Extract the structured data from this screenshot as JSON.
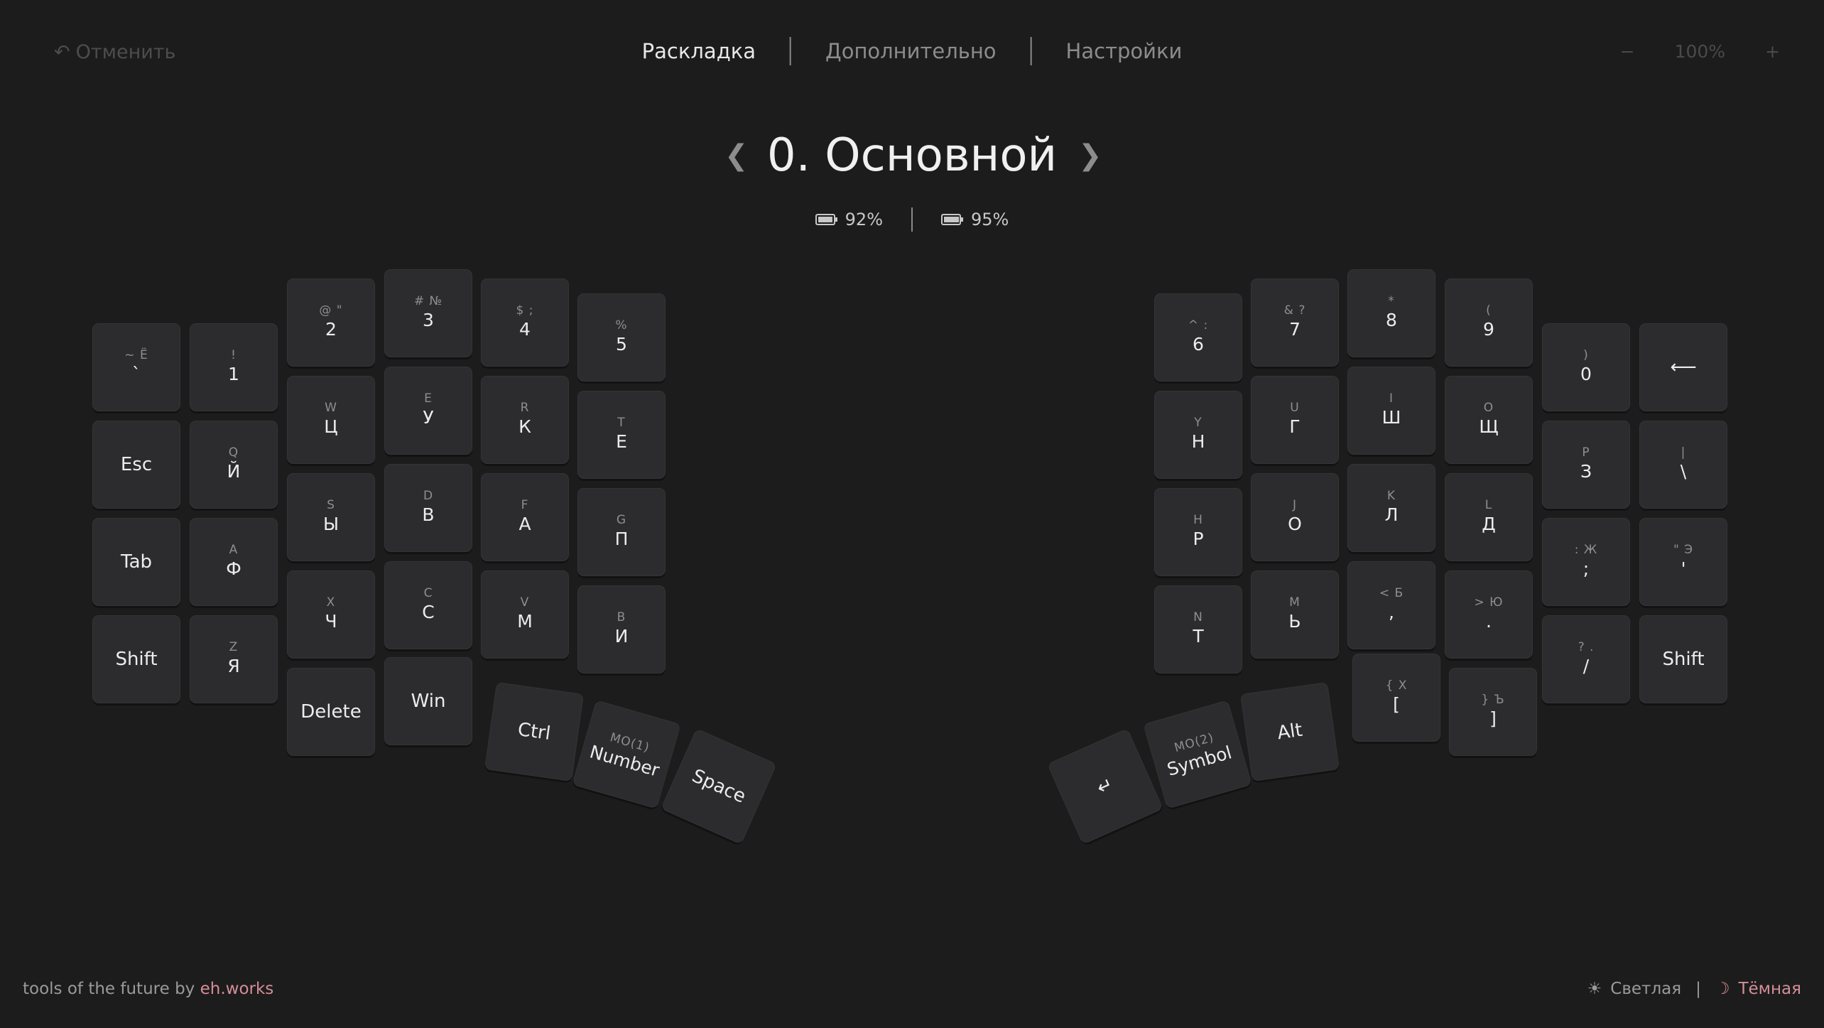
{
  "header": {
    "undo_label": "Отменить",
    "tabs": [
      {
        "label": "Раскладка",
        "active": true
      },
      {
        "label": "Дополнительно",
        "active": false
      },
      {
        "label": "Настройки",
        "active": false
      }
    ],
    "zoom_minus": "−",
    "zoom_value": "100%",
    "zoom_plus": "+"
  },
  "layer": {
    "title": "0. Основной",
    "prev": "❮",
    "next": "❯"
  },
  "battery": {
    "left": "92%",
    "right": "95%"
  },
  "left_keys": [
    {
      "id": "lk-grave",
      "top": "~ Ё",
      "main": "`"
    },
    {
      "id": "lk-1",
      "top": "!",
      "main": "1"
    },
    {
      "id": "lk-2",
      "top": "@ \"",
      "main": "2"
    },
    {
      "id": "lk-3",
      "top": "# №",
      "main": "3"
    },
    {
      "id": "lk-4",
      "top": "$ ;",
      "main": "4"
    },
    {
      "id": "lk-5",
      "top": "%",
      "main": "5"
    },
    {
      "id": "lk-esc",
      "top": "",
      "main": "Esc"
    },
    {
      "id": "lk-q",
      "top": "Q",
      "main": "Й"
    },
    {
      "id": "lk-w",
      "top": "W",
      "main": "Ц"
    },
    {
      "id": "lk-e",
      "top": "E",
      "main": "У"
    },
    {
      "id": "lk-r",
      "top": "R",
      "main": "К"
    },
    {
      "id": "lk-t",
      "top": "T",
      "main": "Е"
    },
    {
      "id": "lk-tab",
      "top": "",
      "main": "Tab"
    },
    {
      "id": "lk-a",
      "top": "A",
      "main": "Ф"
    },
    {
      "id": "lk-s",
      "top": "S",
      "main": "Ы"
    },
    {
      "id": "lk-d",
      "top": "D",
      "main": "В"
    },
    {
      "id": "lk-f",
      "top": "F",
      "main": "А"
    },
    {
      "id": "lk-g",
      "top": "G",
      "main": "П"
    },
    {
      "id": "lk-shift",
      "top": "",
      "main": "Shift"
    },
    {
      "id": "lk-z",
      "top": "Z",
      "main": "Я"
    },
    {
      "id": "lk-x",
      "top": "X",
      "main": "Ч"
    },
    {
      "id": "lk-c",
      "top": "C",
      "main": "С"
    },
    {
      "id": "lk-v",
      "top": "V",
      "main": "М"
    },
    {
      "id": "lk-b",
      "top": "B",
      "main": "И"
    },
    {
      "id": "lk-delete",
      "top": "",
      "main": "Delete"
    },
    {
      "id": "lk-win",
      "top": "",
      "main": "Win"
    },
    {
      "id": "lk-ctrl",
      "top": "",
      "main": "Ctrl"
    },
    {
      "id": "lk-number",
      "top": "MO(1)",
      "main": "Number"
    },
    {
      "id": "lk-space",
      "top": "",
      "main": "Space"
    }
  ],
  "right_keys": [
    {
      "id": "rk-6",
      "top": "^ :",
      "main": "6"
    },
    {
      "id": "rk-7",
      "top": "& ?",
      "main": "7"
    },
    {
      "id": "rk-8",
      "top": "*",
      "main": "8"
    },
    {
      "id": "rk-9",
      "top": "(",
      "main": "9"
    },
    {
      "id": "rk-0",
      "top": ")",
      "main": "0"
    },
    {
      "id": "rk-backspace",
      "top": "",
      "main": "⟵"
    },
    {
      "id": "rk-y",
      "top": "Y",
      "main": "Н"
    },
    {
      "id": "rk-u",
      "top": "U",
      "main": "Г"
    },
    {
      "id": "rk-i",
      "top": "I",
      "main": "Ш"
    },
    {
      "id": "rk-o",
      "top": "O",
      "main": "Щ"
    },
    {
      "id": "rk-p",
      "top": "P",
      "main": "З"
    },
    {
      "id": "rk-bslash",
      "top": "|",
      "main": "\\"
    },
    {
      "id": "rk-h",
      "top": "H",
      "main": "Р"
    },
    {
      "id": "rk-j",
      "top": "J",
      "main": "О"
    },
    {
      "id": "rk-k",
      "top": "K",
      "main": "Л"
    },
    {
      "id": "rk-l",
      "top": "L",
      "main": "Д"
    },
    {
      "id": "rk-semicolon",
      "top": ": Ж",
      "main": ";"
    },
    {
      "id": "rk-quote",
      "top": "\" Э",
      "main": "'"
    },
    {
      "id": "rk-n",
      "top": "N",
      "main": "Т"
    },
    {
      "id": "rk-m",
      "top": "M",
      "main": "Ь"
    },
    {
      "id": "rk-comma",
      "top": "< Б",
      "main": ","
    },
    {
      "id": "rk-period",
      "top": "> Ю",
      "main": "."
    },
    {
      "id": "rk-slash",
      "top": "? .",
      "main": "/"
    },
    {
      "id": "rk-shift",
      "top": "",
      "main": "Shift"
    },
    {
      "id": "rk-lbracket",
      "top": "{ Х",
      "main": "["
    },
    {
      "id": "rk-rbracket",
      "top": "} Ъ",
      "main": "]"
    },
    {
      "id": "rk-alt",
      "top": "",
      "main": "Alt"
    },
    {
      "id": "rk-symbol",
      "top": "MO(2)",
      "main": "Symbol"
    },
    {
      "id": "rk-enter",
      "top": "",
      "main": "↵"
    }
  ],
  "footer": {
    "credit_prefix": "tools of the future by ",
    "credit_link": "eh.works",
    "theme_light": "Светлая",
    "theme_sep": "|",
    "theme_dark": "Тёмная"
  },
  "colors": {
    "background": "#1c1c1c",
    "key": "#2c2c2e",
    "accent": "#d58e98"
  }
}
